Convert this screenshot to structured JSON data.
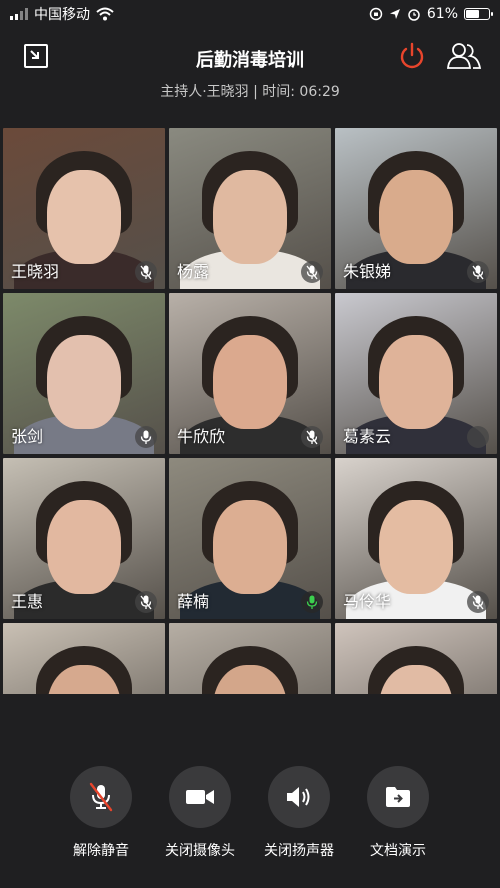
{
  "status_bar": {
    "carrier": "中国移动",
    "battery_percent": "61%",
    "battery_level": 0.61
  },
  "header": {
    "title": "后勤消毒培训",
    "subtitle": "主持人·王晓羽 | 时间: 06:29",
    "power_color": "#e8452c"
  },
  "participants": [
    {
      "name": "王晓羽",
      "mic": "muted"
    },
    {
      "name": "杨露",
      "mic": "muted"
    },
    {
      "name": "朱银娣",
      "mic": "muted"
    },
    {
      "name": "张剑",
      "mic": "idle"
    },
    {
      "name": "牛欣欣",
      "mic": "muted"
    },
    {
      "name": "葛素云",
      "mic": "off"
    },
    {
      "name": "王惠",
      "mic": "muted"
    },
    {
      "name": "薛楠",
      "mic": "speaking"
    },
    {
      "name": "马伶华",
      "mic": "muted"
    },
    {
      "name": "",
      "mic": "none"
    },
    {
      "name": "",
      "mic": "none"
    },
    {
      "name": "",
      "mic": "none"
    }
  ],
  "controls": {
    "unmute": "解除静音",
    "camera_off": "关闭摄像头",
    "speaker_off": "关闭扬声器",
    "doc_present": "文档演示"
  },
  "colors": {
    "speaking_mic": "#3ccf4e",
    "background": "#1f1f21"
  }
}
